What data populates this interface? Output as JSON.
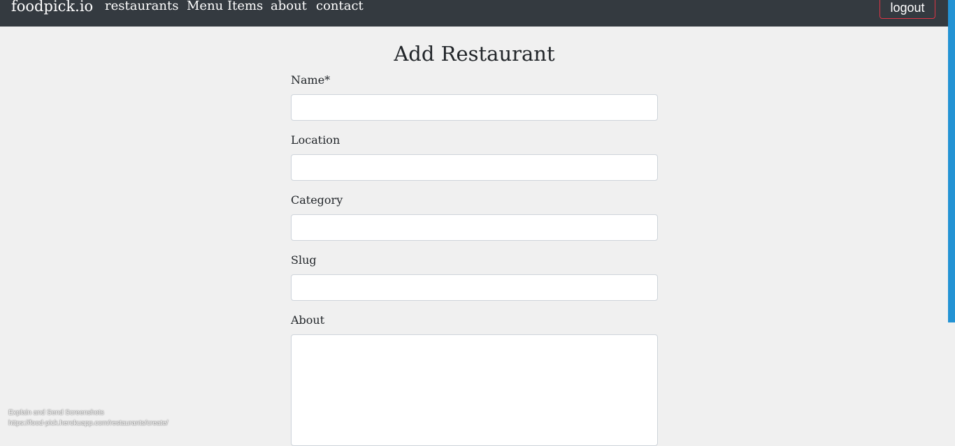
{
  "navbar": {
    "brand": "foodpick.io",
    "links": [
      "restaurants",
      "Menu Items",
      "about",
      "contact"
    ],
    "logout_label": "logout"
  },
  "form": {
    "title": "Add Restaurant",
    "fields": {
      "name": {
        "label": "Name*",
        "value": ""
      },
      "location": {
        "label": "Location",
        "value": ""
      },
      "category": {
        "label": "Category",
        "value": ""
      },
      "slug": {
        "label": "Slug",
        "value": ""
      },
      "about": {
        "label": "About",
        "value": ""
      }
    }
  },
  "overlay": {
    "line1": "Explain and Send Screenshots",
    "line2": "https://food-pick.herokuapp.com/restaurants/create/"
  },
  "colors": {
    "navbar_bg": "#343a40",
    "page_bg": "#f0f0f0",
    "logout_border": "#dc3545",
    "scrollbar": "#2393d4"
  }
}
